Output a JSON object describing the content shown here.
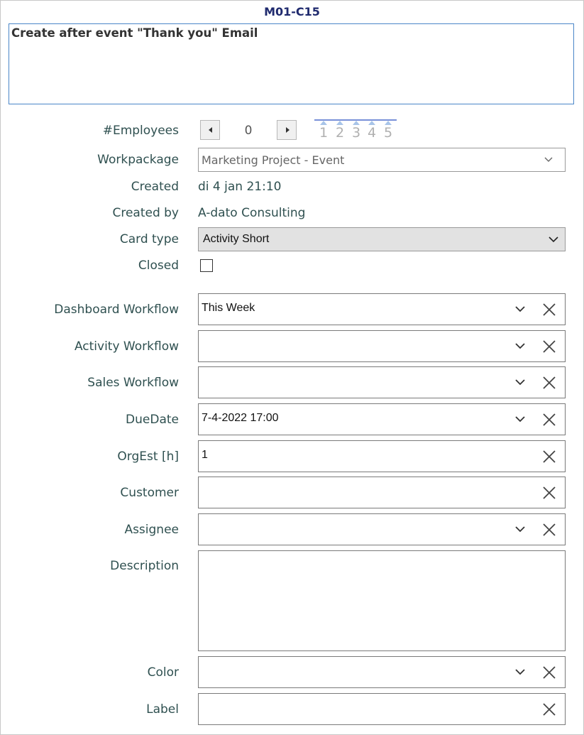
{
  "card": {
    "id": "M01-C15",
    "title": "Create after event \"Thank you\" Email"
  },
  "employees": {
    "label": "#Employees",
    "value": "0",
    "rating_numbers": [
      "1",
      "2",
      "3",
      "4",
      "5"
    ]
  },
  "workpackage": {
    "label": "Workpackage",
    "value": "Marketing Project  - Event"
  },
  "created": {
    "label": "Created",
    "value": "di 4 jan 21:10"
  },
  "created_by": {
    "label": "Created by",
    "value": "A-dato Consulting"
  },
  "card_type": {
    "label": "Card type",
    "value": "Activity  Short"
  },
  "closed": {
    "label": "Closed",
    "checked": false
  },
  "fields": {
    "dashboard_workflow": {
      "label": "Dashboard Workflow",
      "value": "This Week"
    },
    "activity_workflow": {
      "label": "Activity Workflow",
      "value": ""
    },
    "sales_workflow": {
      "label": "Sales Workflow",
      "value": ""
    },
    "due_date": {
      "label": "DueDate",
      "value": "7-4-2022 17:00"
    },
    "org_est": {
      "label": "OrgEst [h]",
      "value": "1"
    },
    "customer": {
      "label": "Customer",
      "value": ""
    },
    "assignee": {
      "label": "Assignee",
      "value": ""
    },
    "description": {
      "label": "Description",
      "value": ""
    },
    "color": {
      "label": "Color",
      "value": ""
    },
    "label": {
      "label": "Label",
      "value": ""
    }
  },
  "icons": {
    "stepper_left": "caret-left-icon",
    "stepper_right": "caret-right-icon",
    "dropdown": "chevron-down-icon",
    "clear": "close-icon"
  },
  "colors": {
    "card_id": "#1f2a6e",
    "title_border": "#4a86c8",
    "label_text": "#2f5050",
    "rating_line": "#7890d8"
  }
}
